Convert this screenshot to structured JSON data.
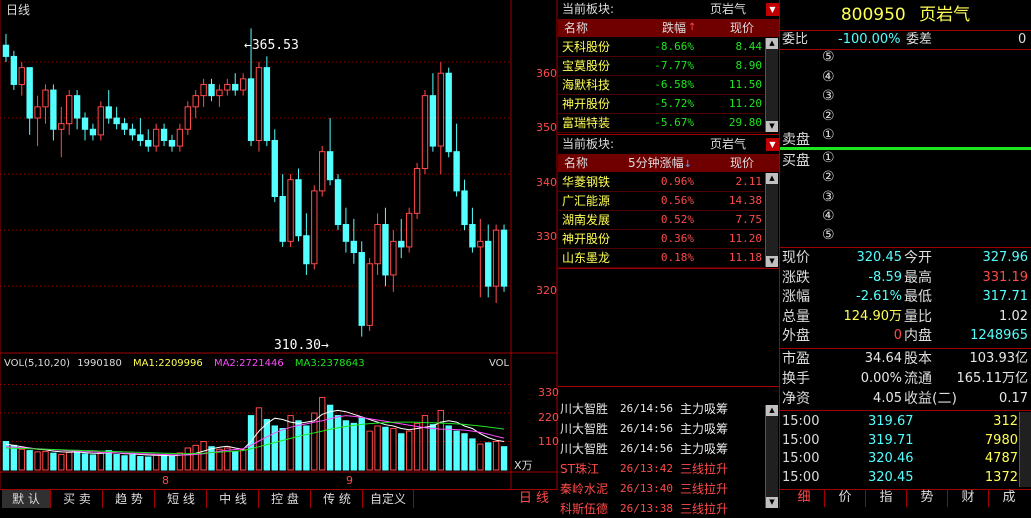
{
  "chart": {
    "period_label": "日线",
    "high_label": "365.53",
    "low_label": "310.30",
    "price_ticks": [
      "360",
      "350",
      "340",
      "330",
      "320"
    ],
    "vol_ticks": [
      "330",
      "220",
      "110"
    ],
    "vol_unit": "X万",
    "vol_axis_label": "VOL",
    "date_ticks": [
      "8",
      "9"
    ],
    "vol_legend": {
      "prefix": "VOL(5,10,20)",
      "vol": "1990180",
      "ma1": "MA1:2209996",
      "ma2": "MA2:2721446",
      "ma3": "MA3:2378643"
    },
    "period_tab": "日 线",
    "colors": {
      "up": "#ff4a4a",
      "down": "#54ffff",
      "grid": "#a00000",
      "ma1": "#ffffff",
      "ma2": "#ff4aff",
      "ma3": "#1ee61e"
    }
  },
  "chart_data": {
    "type": "candlestick",
    "candles": [
      [
        363,
        365,
        360,
        361
      ],
      [
        361,
        362,
        355,
        356
      ],
      [
        356,
        360,
        354,
        359
      ],
      [
        359,
        359,
        347,
        350
      ],
      [
        350,
        354,
        345,
        352
      ],
      [
        352,
        356,
        349,
        355
      ],
      [
        355,
        356,
        346,
        348
      ],
      [
        348,
        352,
        343,
        349
      ],
      [
        349,
        355,
        347,
        354
      ],
      [
        354,
        355,
        348,
        350
      ],
      [
        350,
        351,
        346,
        348
      ],
      [
        348,
        349,
        346,
        347
      ],
      [
        347,
        353,
        346,
        352
      ],
      [
        352,
        355,
        349,
        350
      ],
      [
        350,
        352,
        348,
        349
      ],
      [
        349,
        350,
        347,
        348
      ],
      [
        348,
        349,
        346,
        347
      ],
      [
        347,
        350,
        345,
        346
      ],
      [
        346,
        348,
        344,
        345
      ],
      [
        345,
        349,
        344,
        348
      ],
      [
        348,
        349,
        345,
        346
      ],
      [
        346,
        347,
        344,
        345
      ],
      [
        345,
        349,
        344,
        348
      ],
      [
        348,
        353,
        347,
        352
      ],
      [
        352,
        355,
        350,
        354
      ],
      [
        354,
        357,
        352,
        356
      ],
      [
        356,
        357,
        353,
        354
      ],
      [
        354,
        356,
        352,
        355
      ],
      [
        355,
        357,
        354,
        356
      ],
      [
        356,
        358,
        354,
        355
      ],
      [
        355,
        358,
        354,
        357
      ],
      [
        357,
        366,
        345,
        346
      ],
      [
        346,
        360,
        344,
        359
      ],
      [
        359,
        361,
        345,
        346
      ],
      [
        346,
        348,
        335,
        336
      ],
      [
        336,
        340,
        327,
        328
      ],
      [
        328,
        340,
        327,
        339
      ],
      [
        339,
        341,
        328,
        329
      ],
      [
        329,
        333,
        322,
        324
      ],
      [
        324,
        338,
        323,
        337
      ],
      [
        337,
        345,
        336,
        344
      ],
      [
        344,
        350,
        338,
        339
      ],
      [
        339,
        340,
        330,
        331
      ],
      [
        331,
        334,
        326,
        328
      ],
      [
        328,
        332,
        324,
        326
      ],
      [
        326,
        328,
        311,
        313
      ],
      [
        313,
        325,
        312,
        324
      ],
      [
        324,
        333,
        322,
        331
      ],
      [
        331,
        334,
        320,
        322
      ],
      [
        322,
        330,
        319,
        328
      ],
      [
        328,
        332,
        325,
        327
      ],
      [
        327,
        334,
        326,
        333
      ],
      [
        333,
        342,
        332,
        341
      ],
      [
        341,
        355,
        340,
        354
      ],
      [
        354,
        358,
        344,
        345
      ],
      [
        345,
        360,
        340,
        358
      ],
      [
        358,
        359,
        343,
        344
      ],
      [
        344,
        349,
        336,
        337
      ],
      [
        337,
        339,
        330,
        331
      ],
      [
        331,
        334,
        326,
        327
      ],
      [
        327,
        332,
        318,
        328
      ],
      [
        328,
        331,
        318,
        320
      ],
      [
        320,
        331,
        317,
        330
      ],
      [
        330,
        331,
        319,
        320
      ]
    ],
    "volumes": [
      110,
      95,
      80,
      75,
      70,
      72,
      65,
      60,
      68,
      70,
      62,
      58,
      66,
      75,
      60,
      55,
      58,
      52,
      50,
      60,
      58,
      52,
      66,
      85,
      95,
      110,
      90,
      80,
      85,
      70,
      78,
      210,
      240,
      195,
      170,
      160,
      210,
      190,
      170,
      220,
      280,
      250,
      210,
      190,
      180,
      200,
      150,
      170,
      165,
      160,
      140,
      150,
      180,
      210,
      175,
      230,
      170,
      150,
      140,
      120,
      100,
      105,
      110,
      90
    ],
    "vol_ma": {
      "ma1": [
        100,
        95,
        90,
        85,
        80,
        78,
        73,
        70,
        69,
        70,
        67,
        65,
        64,
        67,
        66,
        63,
        62,
        60,
        58,
        57,
        56,
        55,
        57,
        60,
        65,
        73,
        82,
        88,
        92,
        85,
        80,
        110,
        150,
        180,
        200,
        195,
        185,
        180,
        185,
        190,
        215,
        225,
        230,
        225,
        215,
        205,
        195,
        185,
        175,
        170,
        160,
        155,
        160,
        165,
        170,
        185,
        190,
        185,
        170,
        160,
        140,
        125,
        115,
        110
      ],
      "ma2": [
        90,
        88,
        86,
        84,
        82,
        80,
        78,
        76,
        74,
        73,
        72,
        70,
        68,
        67,
        66,
        65,
        64,
        63,
        62,
        61,
        60,
        59,
        58,
        58,
        60,
        63,
        67,
        72,
        76,
        79,
        82,
        95,
        112,
        128,
        143,
        155,
        165,
        172,
        178,
        185,
        190,
        198,
        205,
        210,
        207,
        203,
        198,
        193,
        188,
        183,
        178,
        173,
        168,
        163,
        160,
        158,
        157,
        156,
        154,
        150,
        145,
        138,
        130,
        123
      ],
      "ma3": [
        85,
        84,
        83,
        82,
        81,
        80,
        79,
        78,
        77,
        76,
        75,
        74,
        73,
        72,
        71,
        70,
        69,
        68,
        67,
        66,
        65,
        64,
        63,
        63,
        64,
        65,
        67,
        69,
        71,
        73,
        75,
        82,
        90,
        98,
        106,
        114,
        122,
        130,
        137,
        143,
        150,
        157,
        163,
        168,
        172,
        176,
        179,
        181,
        183,
        184,
        185,
        185,
        184,
        183,
        182,
        181,
        180,
        178,
        176,
        173,
        170,
        166,
        162,
        158
      ]
    }
  },
  "board1": {
    "title": "当前板块:",
    "sector": "页岩气",
    "columns": [
      "名称",
      "跌幅",
      "现价"
    ],
    "rows": [
      {
        "name": "天科股份",
        "chg": "-8.66%",
        "price": "8.44"
      },
      {
        "name": "宝莫股份",
        "chg": "-7.77%",
        "price": "8.90"
      },
      {
        "name": "海默科技",
        "chg": "-6.58%",
        "price": "11.50"
      },
      {
        "name": "神开股份",
        "chg": "-5.72%",
        "price": "11.20"
      },
      {
        "name": "富瑞特装",
        "chg": "-5.67%",
        "price": "29.80"
      }
    ]
  },
  "board2": {
    "title": "当前板块:",
    "sector": "页岩气",
    "columns": [
      "名称",
      "5分钟涨幅",
      "现价"
    ],
    "rows": [
      {
        "name": "华菱钢铁",
        "chg": "0.96%",
        "price": "2.11"
      },
      {
        "name": "广汇能源",
        "chg": "0.56%",
        "price": "14.38"
      },
      {
        "name": "湖南发展",
        "chg": "0.52%",
        "price": "7.75"
      },
      {
        "name": "神开股份",
        "chg": "0.36%",
        "price": "11.20"
      },
      {
        "name": "山东墨龙",
        "chg": "0.18%",
        "price": "11.18"
      }
    ]
  },
  "alerts": [
    {
      "name": "川大智胜",
      "time": "26/14:56",
      "event": "主力吸筹",
      "color": "white"
    },
    {
      "name": "川大智胜",
      "time": "26/14:56",
      "event": "主力吸筹",
      "color": "white"
    },
    {
      "name": "川大智胜",
      "time": "26/14:56",
      "event": "主力吸筹",
      "color": "white"
    },
    {
      "name": "ST珠江",
      "time": "26/13:42",
      "event": "三线拉升",
      "color": "red"
    },
    {
      "name": "秦岭水泥",
      "time": "26/13:40",
      "event": "三线拉升",
      "color": "red"
    },
    {
      "name": "科斯伍德",
      "time": "26/13:38",
      "event": "三线拉升",
      "color": "red"
    }
  ],
  "quote": {
    "code": "800950",
    "name": "页岩气",
    "wei_bi_label": "委比",
    "wei_bi": "-100.00%",
    "wei_cha_label": "委差",
    "wei_cha": "0",
    "sell_label": "卖盘",
    "buy_label": "买盘",
    "sell_levels": [
      "⑤",
      "④",
      "③",
      "②",
      "①"
    ],
    "buy_levels": [
      "①",
      "②",
      "③",
      "④",
      "⑤"
    ],
    "stats": [
      {
        "l1": "现价",
        "v1": "320.45",
        "c1": "cyan",
        "l2": "今开",
        "v2": "327.96",
        "c2": "cyan"
      },
      {
        "l1": "涨跌",
        "v1": "-8.59",
        "c1": "cyan",
        "l2": "最高",
        "v2": "331.19",
        "c2": "red"
      },
      {
        "l1": "涨幅",
        "v1": "-2.61%",
        "c1": "cyan",
        "l2": "最低",
        "v2": "317.71",
        "c2": "cyan"
      },
      {
        "l1": "总量",
        "v1": "124.90万",
        "c1": "yellow",
        "l2": "量比",
        "v2": "1.02",
        "c2": "white"
      },
      {
        "l1": "外盘",
        "v1": "0",
        "c1": "red",
        "l2": "内盘",
        "v2": "1248965",
        "c2": "cyan"
      }
    ],
    "stats2": [
      {
        "l1": "市盈",
        "v1": "34.64",
        "l2": "股本",
        "v2": "103.93亿"
      },
      {
        "l1": "换手",
        "v1": "0.00%",
        "l2": "流通",
        "v2": "165.11万亿"
      },
      {
        "l1": "净资",
        "v1": "4.05",
        "l2": "收益(二)",
        "v2": "0.17"
      }
    ],
    "ticks": [
      {
        "time": "15:00",
        "price": "319.67",
        "vol": "312"
      },
      {
        "time": "15:00",
        "price": "319.71",
        "vol": "7980"
      },
      {
        "time": "15:00",
        "price": "320.46",
        "vol": "4787"
      },
      {
        "time": "15:00",
        "price": "320.45",
        "vol": "1372"
      }
    ],
    "tabs": [
      "细",
      "价",
      "指",
      "势",
      "财",
      "成"
    ]
  },
  "bottom_tabs": [
    "默 认",
    "买 卖",
    "趋 势",
    "短 线",
    "中 线",
    "控 盘",
    "传 统",
    "自定义"
  ]
}
